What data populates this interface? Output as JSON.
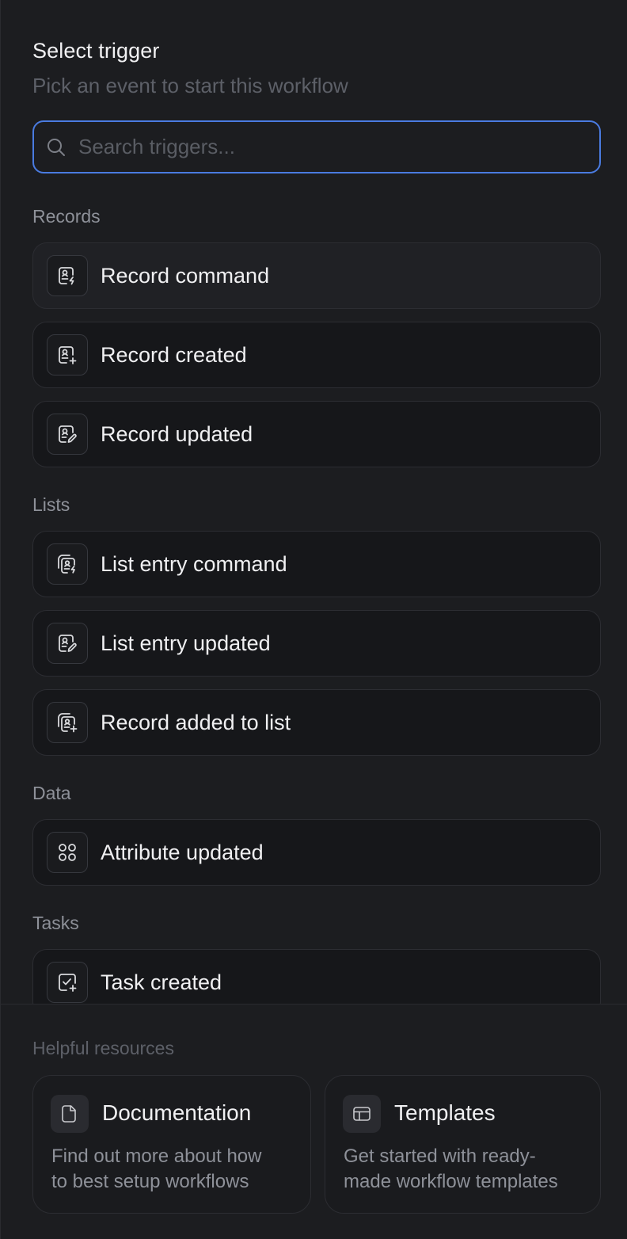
{
  "header": {
    "title": "Select trigger",
    "subtitle": "Pick an event to start this workflow"
  },
  "search": {
    "placeholder": "Search triggers...",
    "value": "",
    "icon": "search-icon"
  },
  "sections": [
    {
      "label": "Records",
      "items": [
        {
          "label": "Record command",
          "icon": "record-command-icon"
        },
        {
          "label": "Record created",
          "icon": "record-created-icon"
        },
        {
          "label": "Record updated",
          "icon": "record-updated-icon"
        }
      ]
    },
    {
      "label": "Lists",
      "items": [
        {
          "label": "List entry command",
          "icon": "list-entry-command-icon"
        },
        {
          "label": "List entry updated",
          "icon": "list-entry-updated-icon"
        },
        {
          "label": "Record added to list",
          "icon": "record-added-to-list-icon"
        }
      ]
    },
    {
      "label": "Data",
      "items": [
        {
          "label": "Attribute updated",
          "icon": "attributes-icon"
        }
      ]
    },
    {
      "label": "Tasks",
      "items": [
        {
          "label": "Task created",
          "icon": "task-created-icon"
        }
      ]
    }
  ],
  "resources": {
    "label": "Helpful resources",
    "cards": [
      {
        "title": "Documentation",
        "desc_line1": "Find out more about how",
        "desc_line2": "to best setup workflows",
        "icon": "document-icon"
      },
      {
        "title": "Templates",
        "desc_line1": "Get started with ready-",
        "desc_line2": "made workflow templates",
        "icon": "template-icon"
      }
    ]
  },
  "colors": {
    "background": "#1c1d20",
    "item_background": "#16171a",
    "focus_border": "#4a7be0",
    "text_primary": "#f0f0f2",
    "text_muted": "#8e9199"
  }
}
